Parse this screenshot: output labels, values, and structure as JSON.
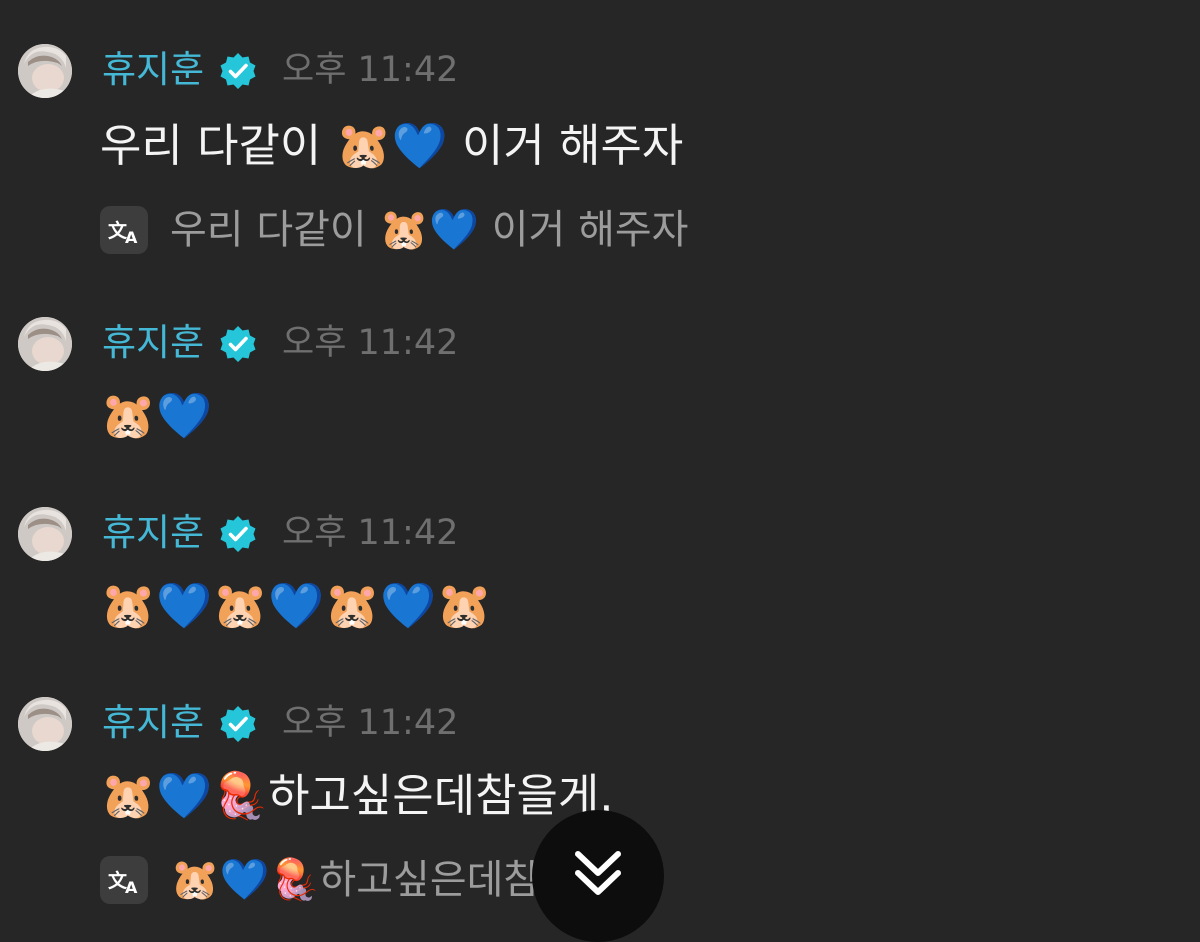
{
  "messages": [
    {
      "sender": "휴지훈",
      "time": "오후 11:42",
      "text": "우리 다같이 🐹💙 이거 해주자",
      "translation": "우리 다같이 🐹💙 이거 해주자"
    },
    {
      "sender": "휴지훈",
      "time": "오후 11:42",
      "text": "🐹💙"
    },
    {
      "sender": "휴지훈",
      "time": "오후 11:42",
      "text": "🐹💙🐹💙🐹💙🐹"
    },
    {
      "sender": "휴지훈",
      "time": "오후 11:42",
      "text": "🐹💙🪼하고싶은데참을게.",
      "translation": "🐹💙🪼하고싶은데참을게."
    }
  ],
  "icons": {
    "verified": "verified-badge-icon",
    "translate": "translate-icon",
    "scroll_down": "double-chevron-down-icon"
  },
  "colors": {
    "background": "#262626",
    "sender": "#45b8d6",
    "verified_badge": "#26c6da",
    "time": "#6f6f6f",
    "message_text": "#f4f4f4",
    "translation_text": "#9c9c9c",
    "scroll_button": "#0d0d0d"
  }
}
